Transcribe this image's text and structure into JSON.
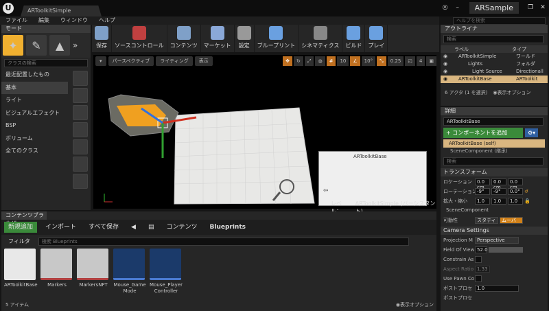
{
  "window": {
    "tab": "ARToolkitSimple",
    "project": "ARSample",
    "buttons": [
      "◎",
      "–",
      "❐",
      "✕"
    ]
  },
  "menu": [
    "ファイル",
    "編集",
    "ウィンドウ",
    "ヘルプ"
  ],
  "help_search": {
    "placeholder": "ヘルプを検索"
  },
  "modes": {
    "title": "モード",
    "search_placeholder": "クラスの検索",
    "categories": [
      "最近配置したもの",
      "基本",
      "ライト",
      "ビジュアルエフェクト",
      "BSP",
      "ボリューム",
      "全てのクラス"
    ],
    "selected": 1
  },
  "toolbar": [
    {
      "label": "保存",
      "icon": "save-icon",
      "color": "#7fa0c8"
    },
    {
      "label": "ソースコントロール",
      "icon": "source-control-icon",
      "color": "#c04040"
    },
    {
      "label": "コンテンツ",
      "icon": "content-icon",
      "color": "#7fa0c8"
    },
    {
      "label": "マーケット",
      "icon": "market-icon",
      "color": "#8aa8d8"
    },
    {
      "label": "設定",
      "icon": "settings-icon",
      "color": "#999"
    },
    {
      "label": "ブループリント",
      "icon": "blueprint-icon",
      "color": "#6aa0e0"
    },
    {
      "label": "シネマティクス",
      "icon": "cinematics-icon",
      "color": "#888"
    },
    {
      "label": "ビルド",
      "icon": "build-icon",
      "color": "#6aa0e0"
    },
    {
      "label": "プレイ",
      "icon": "play-icon",
      "color": "#6aa0e0"
    }
  ],
  "viewport": {
    "perspective": "パースペクティブ",
    "lighting": "ライティング",
    "show": "表示",
    "grid": "10",
    "angle": "10°",
    "scale": "0.25",
    "cam": "4",
    "level_label": "レベル：",
    "level_name": "ARToolkitSimple (パーシスタント)",
    "minimap_title": "ARToolkitBase"
  },
  "outliner": {
    "title": "アウトライナ",
    "search_placeholder": "検索",
    "col_label": "ラベル",
    "col_type": "タイプ",
    "rows": [
      {
        "label": "ARToolkitSimple",
        "type": "ワールド"
      },
      {
        "label": "Lights",
        "type": "フォルダ"
      },
      {
        "label": "Light Source",
        "type": "Directionall"
      },
      {
        "label": "ARToolkitBase",
        "type": "ARToolkit"
      }
    ],
    "footer": "6 アクタ (1 を選択)",
    "view_options": "表示オプション"
  },
  "details": {
    "title": "詳細",
    "name": "ARToolkitBase",
    "add_component": "+ コンポーネントを追加",
    "self": "ARToolkitBase (self)",
    "scene": "SceneComponent (継承)",
    "search_placeholder": "検索",
    "transform": "トランスフォーム",
    "location": "ロケーション",
    "loc": [
      "0.0 cm",
      "0.0 cm",
      "0.0 cm"
    ],
    "rotation": "ローテーション",
    "rot": [
      "-9°",
      "-9°",
      "0.0°"
    ],
    "scale_label": "拡大・縮小",
    "scale": [
      "1.0",
      "1.0",
      "1.0"
    ],
    "scene_comp": "SceneComponent",
    "mobility": "可動性",
    "static": "スタティ",
    "movable": "ムーバ",
    "camera": "Camera Settings",
    "proj_label": "Projection M",
    "proj_val": "Perspective",
    "fov_label": "Field Of View",
    "fov_val": "52.0",
    "constrain": "Constrain As",
    "aspect": "Aspect Ratio",
    "aspect_val": "1.33",
    "pawn": "Use Pawn Co",
    "post": "ポストプロセ",
    "post_val": "1.0",
    "post2": "ポストプロセ"
  },
  "content_browser": {
    "title": "コンテンツブラウザ",
    "add_new": "新規追加",
    "import": "インポート",
    "save_all": "すべて保存",
    "path_root": "コンテンツ",
    "path_child": "Blueprints",
    "filter": "フィルタ",
    "search_placeholder": "検索 Blueprints",
    "assets": [
      "ARToolkitBase",
      "Markers",
      "MarkersNFT",
      "Mouse_Game Mode",
      "Mouse_Player Controller"
    ],
    "count": "5 アイテム",
    "view_options": "表示オプション"
  }
}
